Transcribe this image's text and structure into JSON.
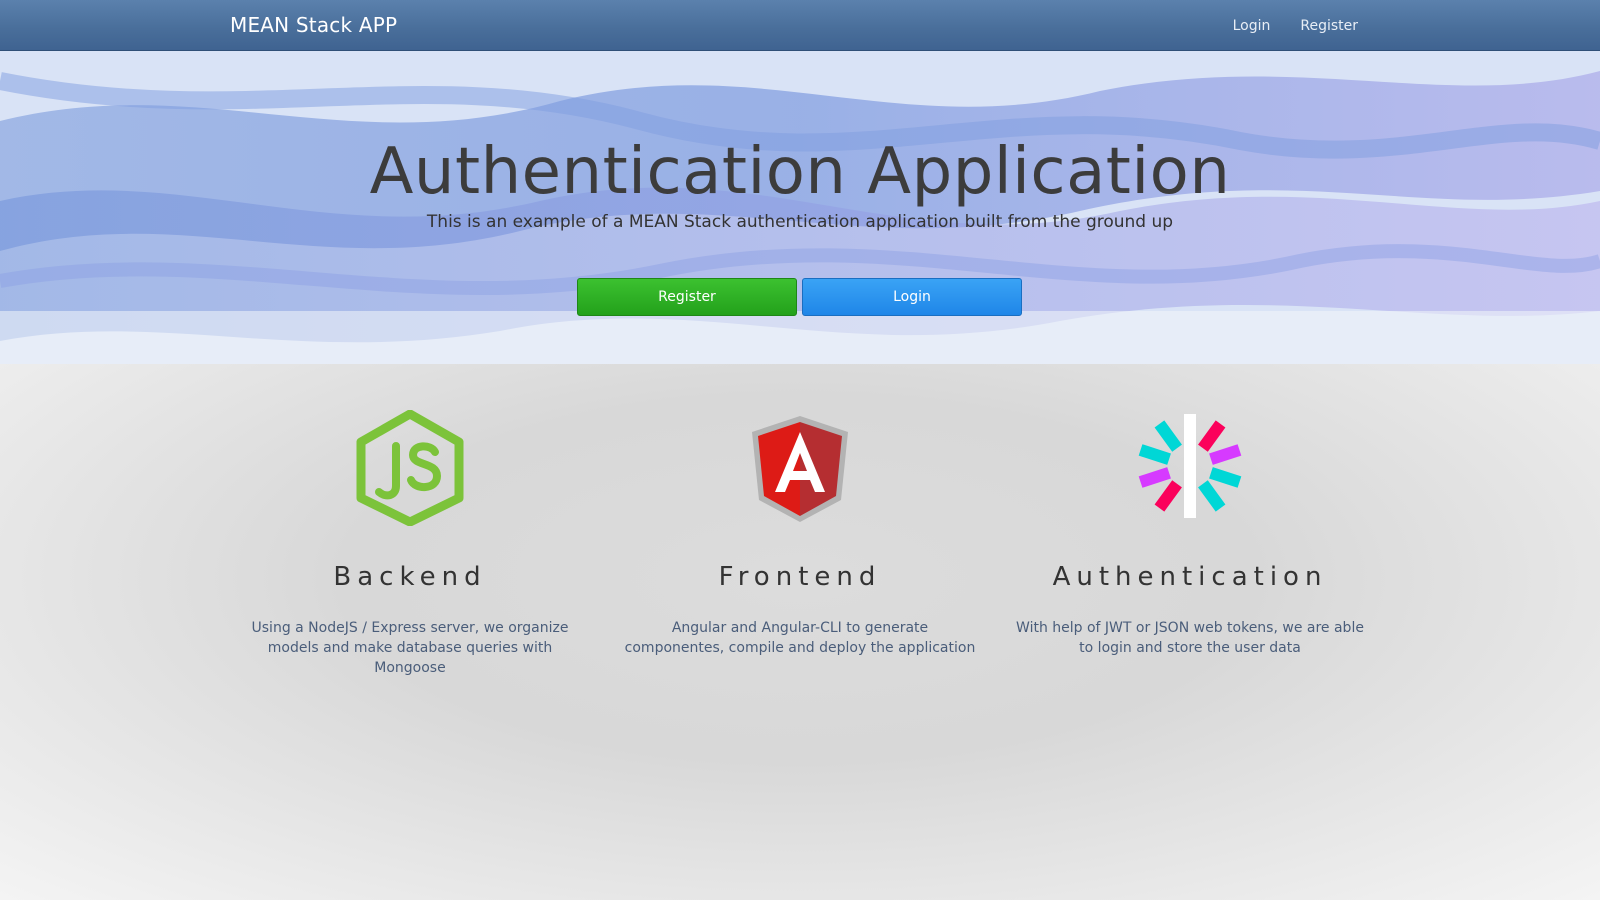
{
  "navbar": {
    "brand": "MEAN Stack APP",
    "links": [
      {
        "label": "Login"
      },
      {
        "label": "Register"
      }
    ]
  },
  "hero": {
    "title": "Authentication Application",
    "subtitle": "This is an example of a MEAN Stack authentication application built from the ground up",
    "register_label": "Register",
    "login_label": "Login"
  },
  "features": [
    {
      "icon": "nodejs-logo",
      "title": "Backend",
      "description": "Using a NodeJS / Express server, we organize models and make database queries with Mongoose"
    },
    {
      "icon": "angular-logo",
      "title": "Frontend",
      "description": "Angular and Angular-CLI to generate componentes, compile and deploy the application"
    },
    {
      "icon": "jwt-logo",
      "title": "Authentication",
      "description": "With help of JWT or JSON web tokens, we are able to login and store the user data"
    }
  ],
  "colors": {
    "navbar": "#4a6f9b",
    "register_button": "#2fb126",
    "login_button": "#2b93ef",
    "nodejs_green": "#7cc33a",
    "angular_red": "#dd1b16"
  }
}
